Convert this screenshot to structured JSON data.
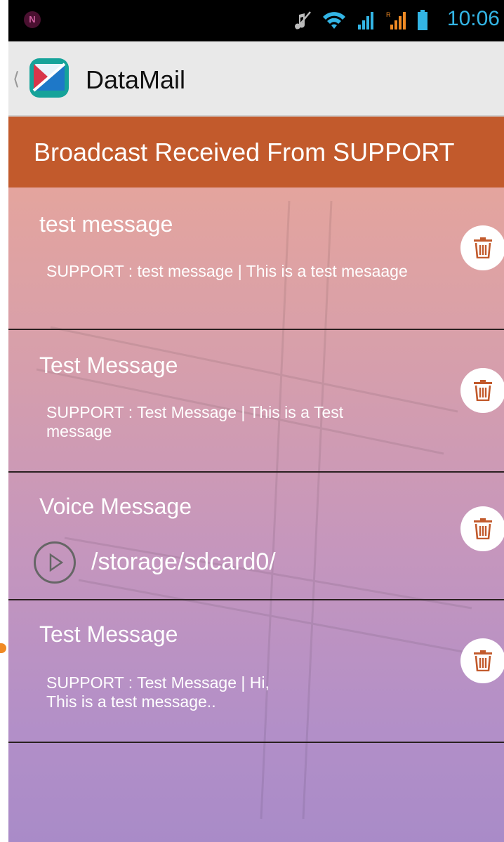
{
  "status_bar": {
    "time": "10:06",
    "notification_icon": "N",
    "icons": [
      "mute-icon",
      "wifi-icon",
      "signal-sim1-icon",
      "signal-sim2-icon",
      "battery-icon"
    ]
  },
  "action_bar": {
    "title": "DataMail",
    "app_icon": "datamail-app-icon"
  },
  "header": {
    "text": "Broadcast Received From SUPPORT",
    "color": "#c25a2c"
  },
  "messages": [
    {
      "title": "test message",
      "body": "SUPPORT : test message | This is a test mesaage",
      "type": "text"
    },
    {
      "title": "Test Message",
      "body": "SUPPORT : Test Message | This is a Test message",
      "type": "text"
    },
    {
      "title": "Voice Message",
      "path": "/storage/sdcard0/",
      "type": "voice"
    },
    {
      "title": "Test Message",
      "body_line1": "SUPPORT : Test Message | Hi,",
      "body_line2": "This is a test message..",
      "type": "text"
    }
  ],
  "colors": {
    "accent_delete": "#c25a2c",
    "status_blue": "#33b5e5"
  }
}
